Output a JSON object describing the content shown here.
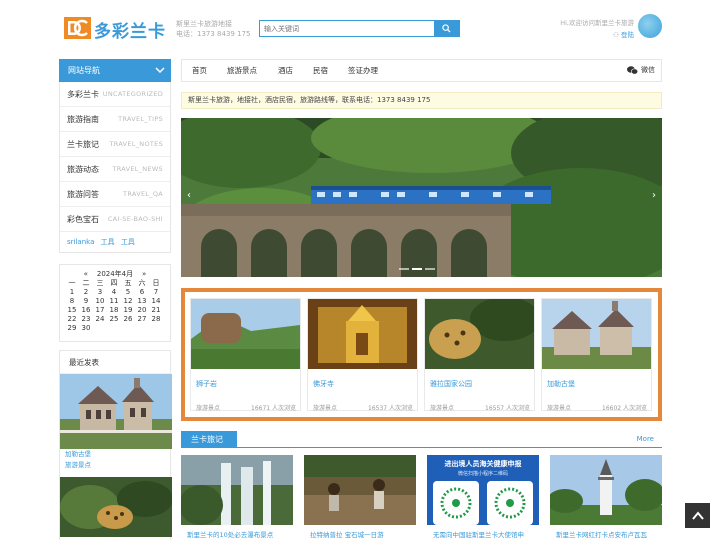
{
  "header": {
    "logo_text": "多彩兰卡",
    "info_line1": "斯里兰卡旅游地接",
    "info_line2": "电话：1373 8439 175",
    "search_placeholder": "输入关键词",
    "welcome": "Hi,欢迎访问斯里兰卡旅游",
    "login": "登陆"
  },
  "sidebar": {
    "nav_title": "网站导航",
    "items": [
      {
        "label": "多彩兰卡",
        "en": "UNCATEGORIZED"
      },
      {
        "label": "旅游指南",
        "en": "TRAVEL_TIPS"
      },
      {
        "label": "兰卡旅记",
        "en": "TRAVEL_NOTES"
      },
      {
        "label": "旅游动态",
        "en": "TRAVEL_NEWS"
      },
      {
        "label": "旅游问答",
        "en": "TRAVEL_QA"
      },
      {
        "label": "彩色宝石",
        "en": "CAI-SE-BAO-SHI"
      }
    ],
    "tags": [
      "srilanka",
      "工具",
      "工具"
    ],
    "calendar": {
      "prev": "«",
      "title": "2024年4月",
      "next": "»",
      "weekdays": [
        "一",
        "二",
        "三",
        "四",
        "五",
        "六",
        "日"
      ],
      "days": [
        "1",
        "2",
        "3",
        "4",
        "5",
        "6",
        "7",
        "8",
        "9",
        "10",
        "11",
        "12",
        "13",
        "14",
        "15",
        "16",
        "17",
        "18",
        "19",
        "20",
        "21",
        "22",
        "23",
        "24",
        "25",
        "26",
        "27",
        "28",
        "29",
        "30"
      ]
    },
    "recent": {
      "title": "最近发表",
      "caption_line1": "加勒古堡",
      "caption_line2": "旅游景点"
    }
  },
  "mainnav": {
    "items": [
      "首页",
      "旅游景点",
      "酒店",
      "民宿",
      "签证办理"
    ],
    "wechat": "微信"
  },
  "notice": "斯里兰卡旅游，地接社，酒店民宿，旅游路线等，联系电话：1373 8439 175",
  "banner": {
    "prev": "‹",
    "next": "›"
  },
  "featured": [
    {
      "title": "狮子岩",
      "category": "旅游景点",
      "views": "16671 人次浏览"
    },
    {
      "title": "佛牙寺",
      "category": "旅游景点",
      "views": "16537 人次浏览"
    },
    {
      "title": "雅拉国家公园",
      "category": "旅游景点",
      "views": "16557 人次浏览"
    },
    {
      "title": "加勒古堡",
      "category": "旅游景点",
      "views": "16602 人次浏览"
    }
  ],
  "section": {
    "title": "兰卡旅记",
    "more": "More"
  },
  "posts": [
    {
      "caption": "斯里兰卡的10处必去瀑布景点"
    },
    {
      "caption": "拉特纳普拉 宝石城一日游"
    },
    {
      "caption": "无需向中国驻斯里兰卡大使馆申",
      "poster_title": "进出境人员海关健康申报",
      "poster_sub": "微信扫描小程序二维码"
    },
    {
      "caption": "斯里兰卡网红打卡点安布卢瓦瓦"
    }
  ],
  "colors": {
    "accent": "#3a9ad9",
    "featured_border": "#e6883c",
    "notice_bg": "#fdfbe2"
  }
}
